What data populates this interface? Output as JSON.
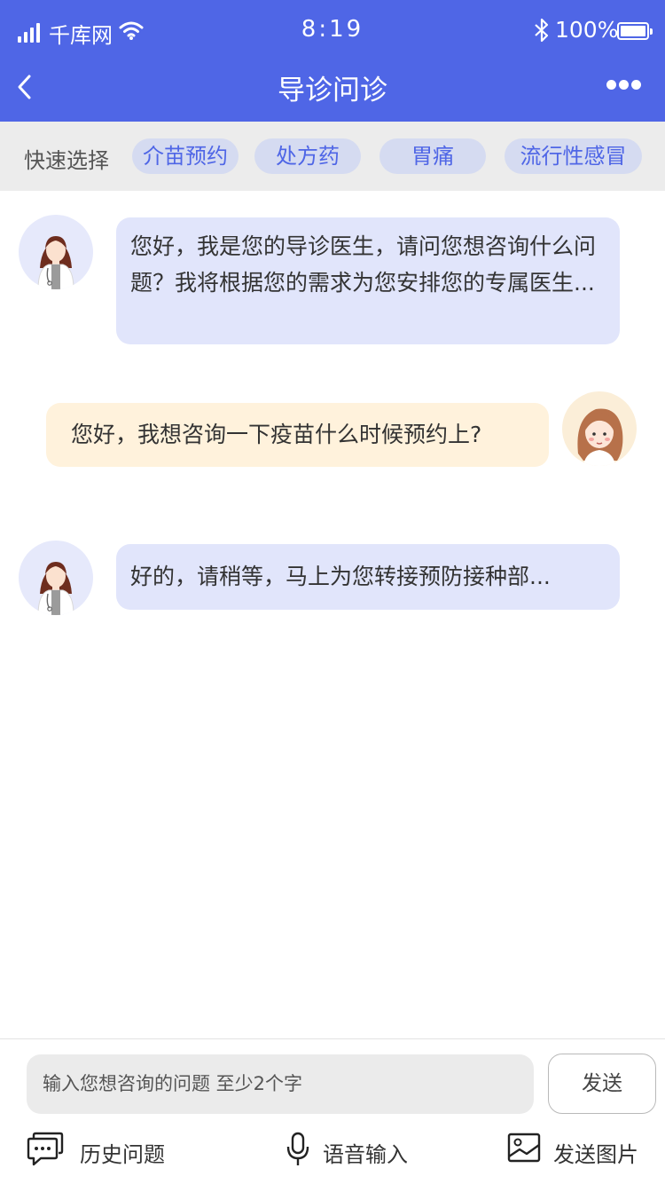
{
  "status_bar": {
    "carrier": "千库网",
    "time": "8:19",
    "battery": "100%"
  },
  "nav": {
    "title": "导诊问诊",
    "back_icon": "chevron-left-icon",
    "more_icon": "more-dots-icon"
  },
  "quick_select": {
    "label": "快速选择",
    "chips": [
      "介苗预约",
      "处方药",
      "胃痛",
      "流行性感冒"
    ]
  },
  "messages": [
    {
      "sender": "doctor",
      "text": "您好，我是您的导诊医生，请问您想咨询什么问题？我将根据您的需求为您安排您的专属医生..."
    },
    {
      "sender": "user",
      "text": "您好，我想咨询一下疫苗什么时候预约上?"
    },
    {
      "sender": "doctor",
      "text": "好的，请稍等，马上为您转接预防接种部..."
    }
  ],
  "composer": {
    "placeholder": "输入您想咨询的问题   至少2个字",
    "send_label": "发送"
  },
  "toolbar": {
    "history": "历史问题",
    "voice": "语音输入",
    "image": "发送图片"
  },
  "colors": {
    "brand": "#4f66e6",
    "doctor_bubble": "#e1e5fb",
    "user_bubble": "#fff2dc",
    "chip_bg": "#d5dbf1"
  }
}
